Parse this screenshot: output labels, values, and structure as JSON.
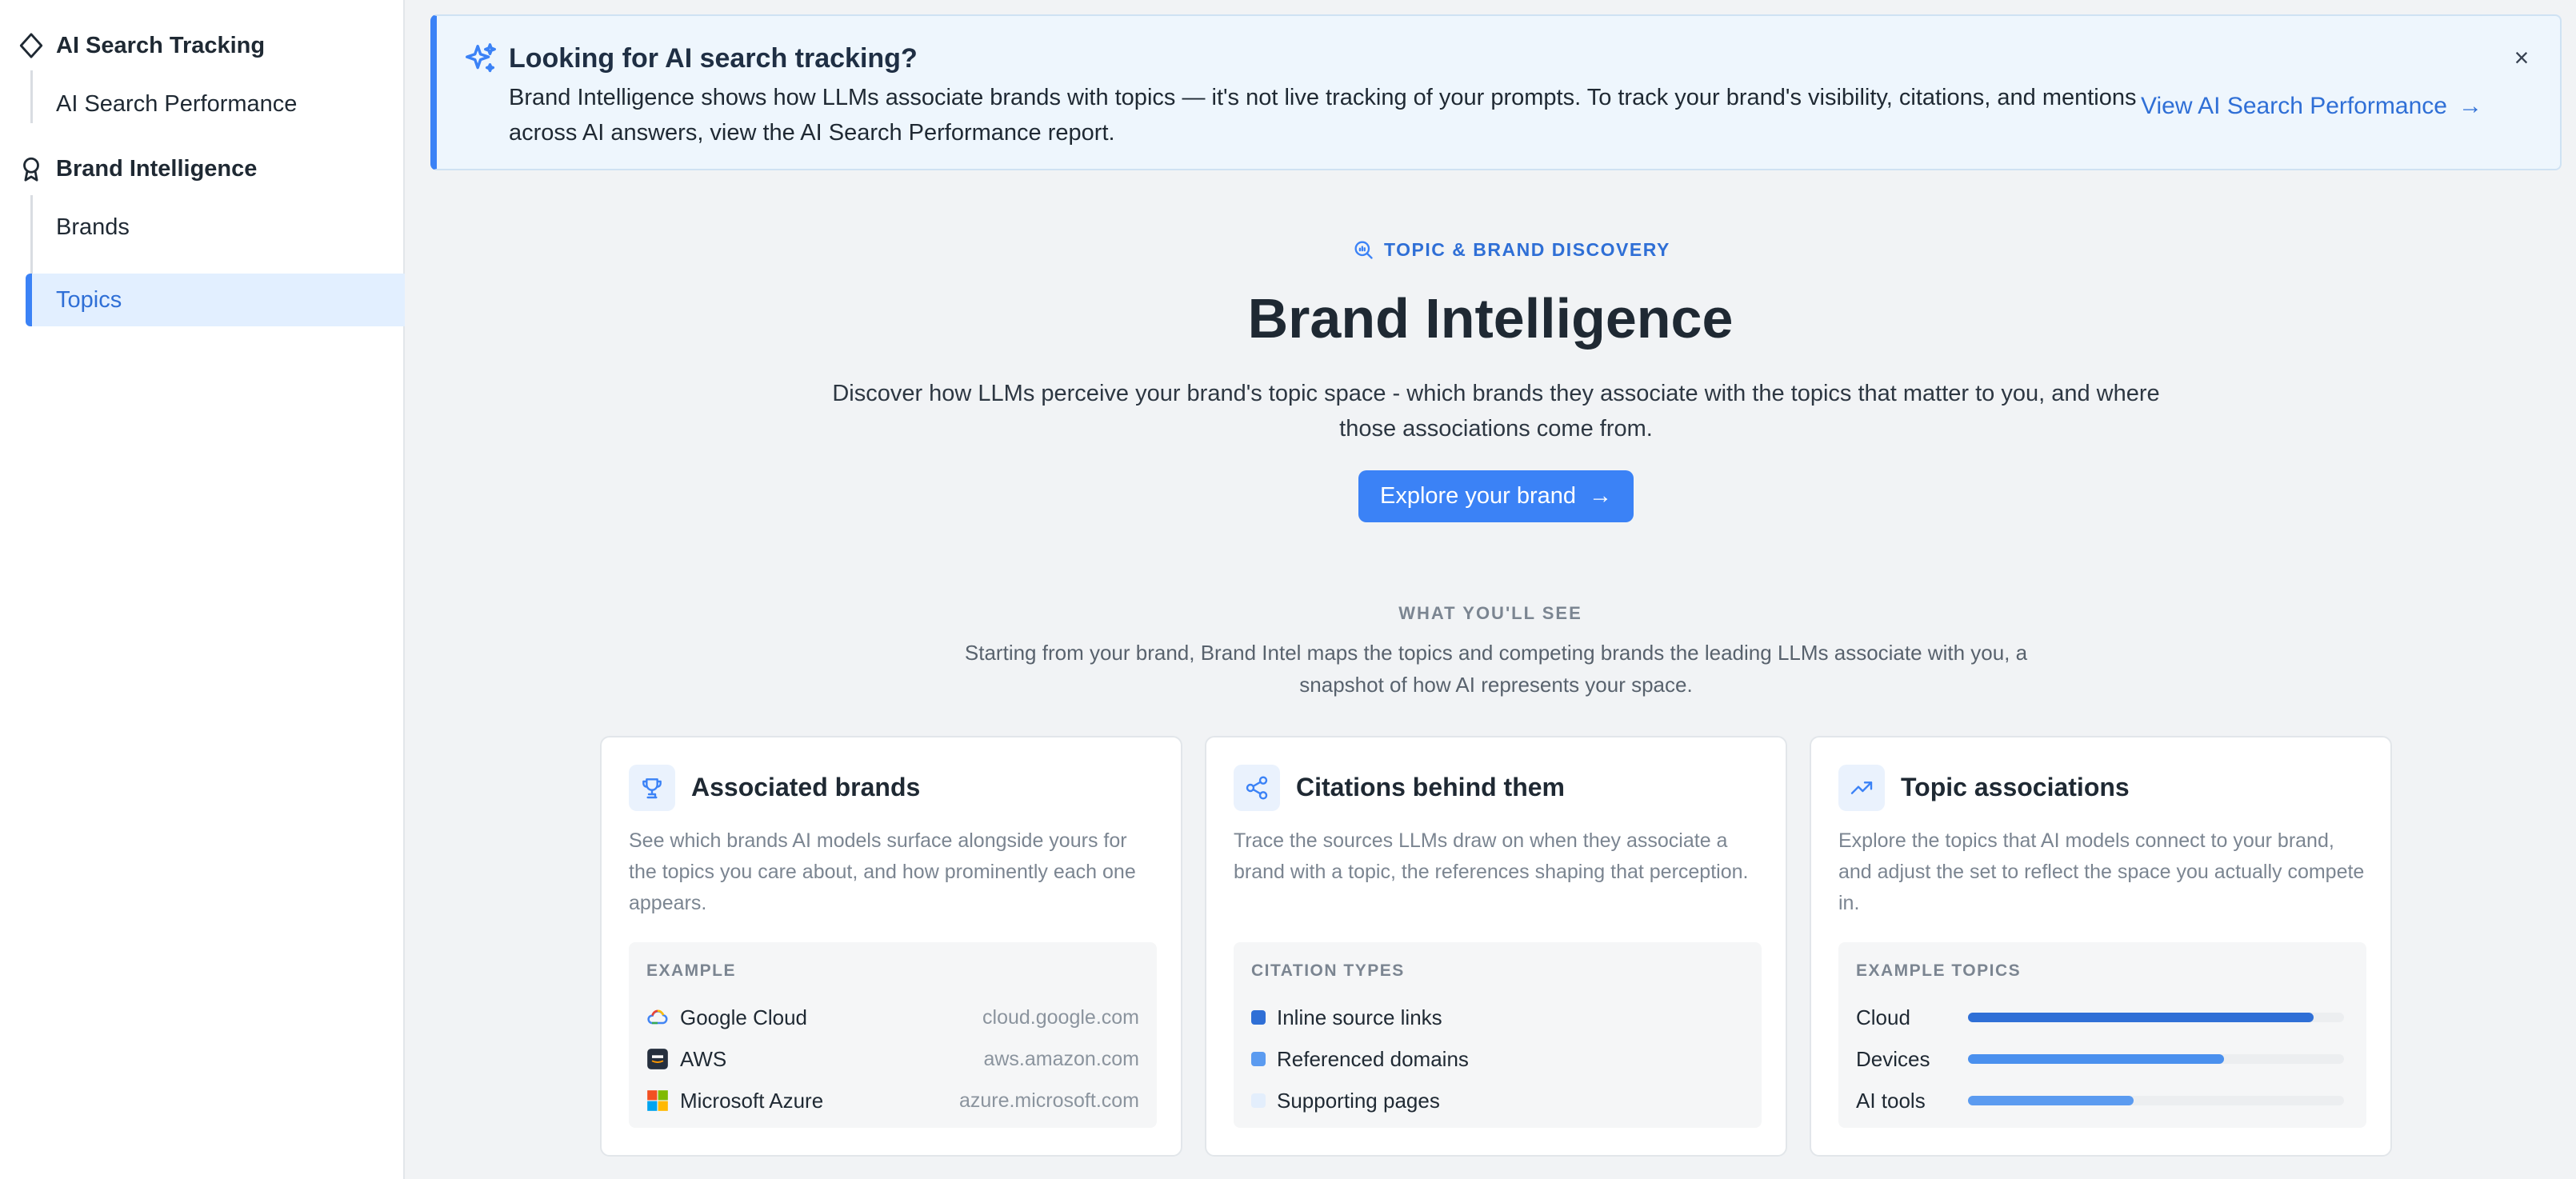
{
  "sidebar": {
    "groups": [
      {
        "title": "AI Search Tracking",
        "icon": "diamond-icon",
        "items": [
          "AI Search Performance"
        ]
      },
      {
        "title": "Brand Intelligence",
        "icon": "award-icon",
        "items": [
          "Brands",
          "Topics"
        ]
      }
    ],
    "active_item": "Topics"
  },
  "banner": {
    "title": "Looking for AI search tracking?",
    "body": "Brand Intelligence shows how LLMs associate brands with topics — it's not live tracking of your prompts. To track your brand's visibility, citations, and mentions across AI answers, view the AI Search Performance report.",
    "link_label": "View AI Search Performance",
    "icon": "sparkles-icon",
    "close_glyph": "×"
  },
  "hero": {
    "tag": "TOPIC & BRAND DISCOVERY",
    "title": "Brand Intelligence",
    "description": "Discover how LLMs perceive your brand's topic space - which brands they associate with the topics that matter to you, and where those associations come from.",
    "button_label": "Explore your brand"
  },
  "what_youll_see": {
    "heading": "WHAT YOU'LL SEE",
    "description": "Starting from your brand, Brand Intel maps the topics and competing brands the leading LLMs associate with you, a snapshot of how AI represents your space."
  },
  "cards": [
    {
      "title": "Associated brands",
      "icon": "trophy-icon",
      "description": "See which brands AI models surface alongside yours for the topics you care about, and how prominently each one appears.",
      "box_heading": "EXAMPLE",
      "rows": [
        {
          "name": "Google Cloud",
          "domain": "cloud.google.com",
          "icon": "google-cloud-logo"
        },
        {
          "name": "AWS",
          "domain": "aws.amazon.com",
          "icon": "aws-logo"
        },
        {
          "name": "Microsoft Azure",
          "domain": "azure.microsoft.com",
          "icon": "microsoft-logo"
        }
      ]
    },
    {
      "title": "Citations behind them",
      "icon": "share-icon",
      "description": "Trace the sources LLMs draw on when they associate a brand with a topic, the references shaping that perception.",
      "box_heading": "CITATION TYPES",
      "rows": [
        {
          "name": "Inline source links",
          "color": "#2f6fd6"
        },
        {
          "name": "Referenced domains",
          "color": "#5b9bf0"
        },
        {
          "name": "Supporting pages",
          "color": "#e3eefc"
        }
      ]
    },
    {
      "title": "Topic associations",
      "icon": "trending-up-icon",
      "description": "Explore the topics that AI models connect to your brand, and adjust the set to reflect the space you actually compete in.",
      "box_heading": "EXAMPLE TOPICS",
      "rows": [
        {
          "name": "Cloud",
          "share": 0.92,
          "color": "#2f6fd6"
        },
        {
          "name": "Devices",
          "share": 0.68,
          "color": "#4a90ee"
        },
        {
          "name": "AI tools",
          "share": 0.44,
          "color": "#5b9bf0"
        }
      ]
    }
  ],
  "colors": {
    "accent": "#3b82f6",
    "accent_text": "#2f6fd6",
    "banner_bg": "#eef6fd",
    "page_bg": "#f1f3f5"
  }
}
